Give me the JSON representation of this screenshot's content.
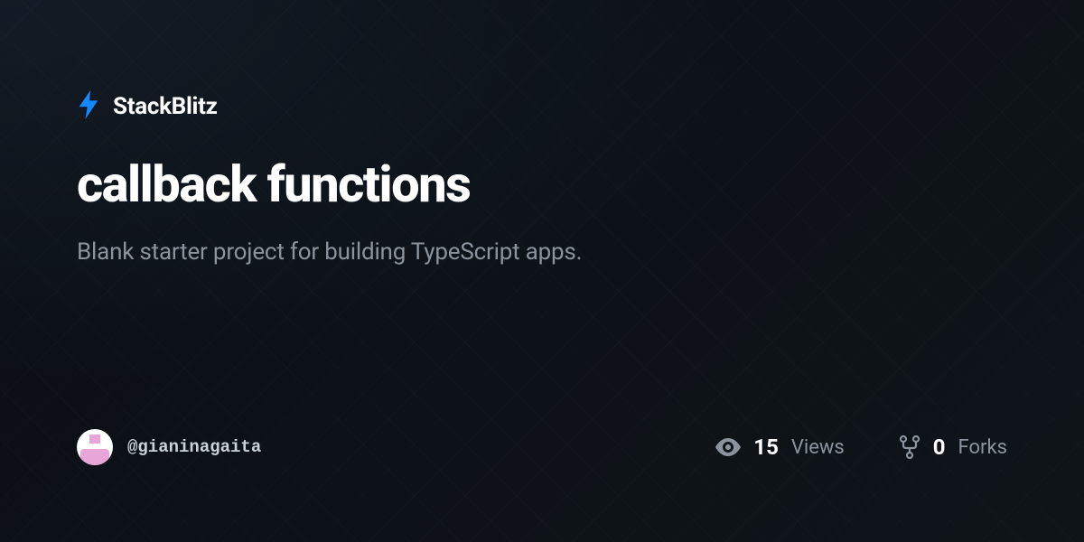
{
  "brand": {
    "name": "StackBlitz"
  },
  "project": {
    "title": "callback functions",
    "description": "Blank starter project for building TypeScript apps."
  },
  "author": {
    "username": "@gianinagaita"
  },
  "stats": {
    "views": {
      "count": "15",
      "label": "Views"
    },
    "forks": {
      "count": "0",
      "label": "Forks"
    }
  }
}
